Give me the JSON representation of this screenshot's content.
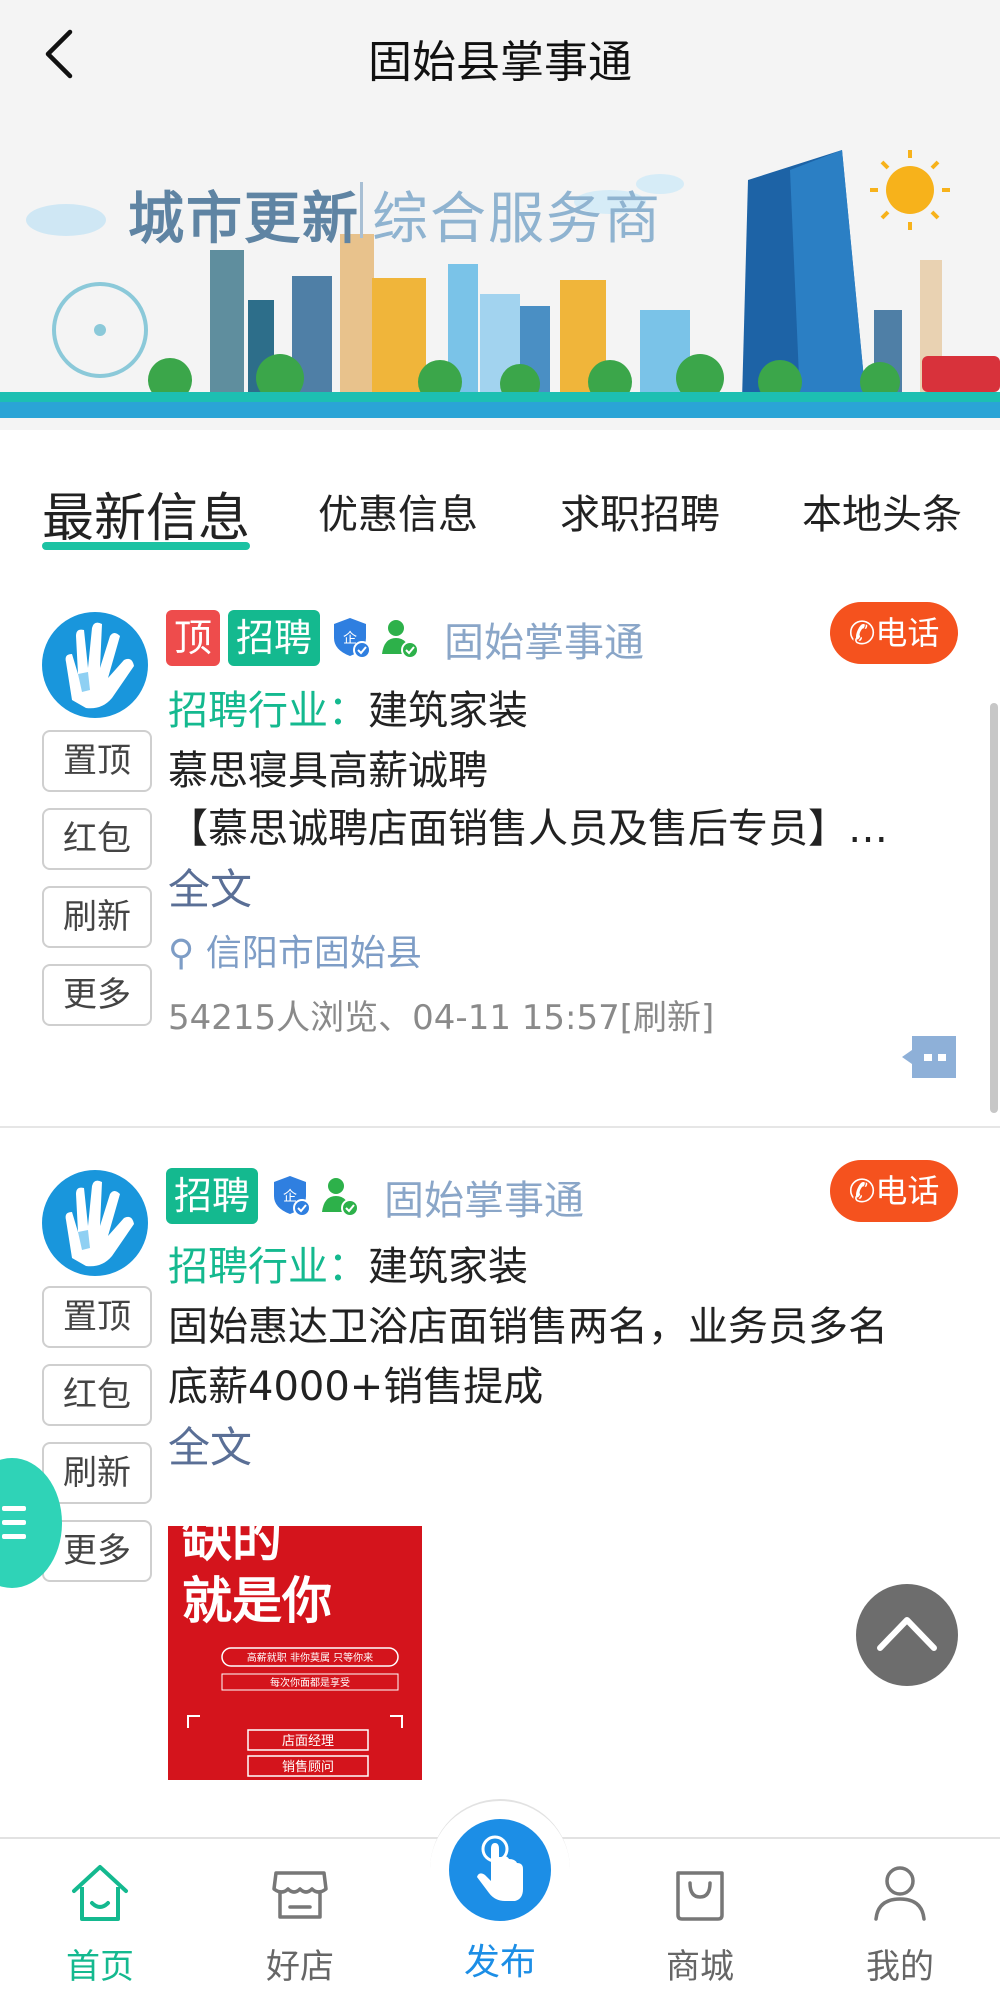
{
  "header": {
    "title": "固始县掌事通"
  },
  "banner": {
    "title": "城市更新",
    "subtitle": "综合服务商"
  },
  "tabs": [
    {
      "label": "最新信息",
      "active": true
    },
    {
      "label": "优惠信息"
    },
    {
      "label": "求职招聘"
    },
    {
      "label": "本地头条"
    }
  ],
  "posts": [
    {
      "badges": [
        "顶",
        "招聘"
      ],
      "publisher": "固始掌事通",
      "call_label": "电话",
      "side_buttons": [
        "置顶",
        "红包",
        "刷新",
        "更多"
      ],
      "industry_key": "招聘行业：",
      "industry_value": "建筑家装",
      "lines": [
        "慕思寝具高薪诚聘",
        "【慕思诚聘店面销售人员及售后专员】…"
      ],
      "fulltext": "全文",
      "location": "信阳市固始县",
      "meta": "54215人浏览、04-11 15:57[刷新]"
    },
    {
      "badges": [
        "招聘"
      ],
      "publisher": "固始掌事通",
      "call_label": "电话",
      "side_buttons": [
        "置顶",
        "红包",
        "刷新",
        "更多"
      ],
      "industry_key": "招聘行业：",
      "industry_value": "建筑家装",
      "lines": [
        "固始惠达卫浴店面销售两名，业务员多名",
        "底薪4000+销售提成"
      ],
      "fulltext": "全文",
      "poster": {
        "headline_1": "缺的",
        "headline_2": "就是你",
        "slogan": "高薪就职 非你莫属 只等你来",
        "perks": "每次你面都是享受",
        "positions": [
          "店面经理",
          "销售顾问"
        ]
      }
    }
  ],
  "bottom_nav": [
    {
      "label": "首页",
      "icon": "home-icon",
      "active": true
    },
    {
      "label": "好店",
      "icon": "store-icon"
    },
    {
      "label": "发布",
      "icon": "tap-hand-icon"
    },
    {
      "label": "商城",
      "icon": "shopping-bag-icon"
    },
    {
      "label": "我的",
      "icon": "user-icon"
    }
  ],
  "colors": {
    "accent": "#14b98f",
    "call": "#f5521e",
    "top_badge": "#ee4c4c",
    "publish": "#1c8ee6",
    "link": "#7e9dc6"
  }
}
